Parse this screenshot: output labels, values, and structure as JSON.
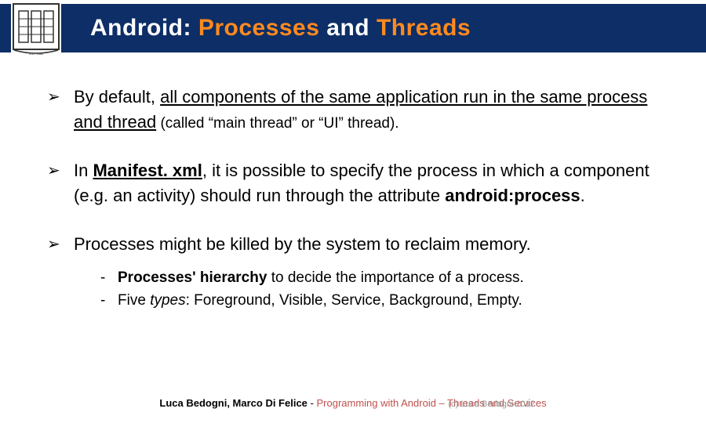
{
  "header": {
    "title_prefix": "Android: ",
    "title_hl1": "Processes",
    "title_mid": " and ",
    "title_hl2": "Threads"
  },
  "bullet1": {
    "lead": "By default, ",
    "under": "all components of the same application run in the same process and thread",
    "tail_small": " (called “main thread” or “UI” thread)."
  },
  "bullet2": {
    "lead": "In ",
    "bold_under": "Manifest. xml",
    "mid": ", it is possible to specify the process in which a component (e.g. an activity)  should run through the attribute ",
    "bold_tail": "android:process",
    "dot": "."
  },
  "bullet3": {
    "text": "Processes might be killed by the system to reclaim memory.",
    "sub1_bold": "Processes' hierarchy",
    "sub1_rest": " to decide the importance of a process.",
    "sub2_lead": "Five ",
    "sub2_ital": "types",
    "sub2_rest": ": Foreground, Visible, Service, Background, Empty."
  },
  "footer": {
    "authors": "Luca Bedogni, Marco Di Felice",
    "sep": " - ",
    "course": "Programming with Android – Threads and Services",
    "overlay": "(c) Luca Bedogni 2012"
  }
}
